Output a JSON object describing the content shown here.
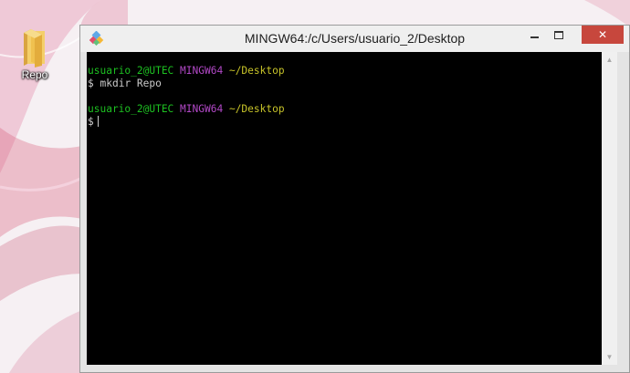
{
  "desktop": {
    "icons": [
      {
        "label": "Repo",
        "icon": "folder-icon"
      }
    ]
  },
  "window": {
    "title": "MINGW64:/c/Users/usuario_2/Desktop",
    "controls": {
      "minimize": "minimize-icon",
      "maximize": "maximize-icon",
      "close": "✕"
    }
  },
  "terminal": {
    "lines": [
      {
        "user": "usuario_2@UTEC",
        "host": "MINGW64",
        "path": "~/Desktop"
      },
      {
        "prompt": "$",
        "command": "mkdir Repo"
      },
      {
        "user": "usuario_2@UTEC",
        "host": "MINGW64",
        "path": "~/Desktop"
      },
      {
        "prompt": "$",
        "command": ""
      }
    ]
  },
  "colors": {
    "user": "#1dc121",
    "host": "#b148c6",
    "path": "#c7c329",
    "text": "#cbcbcb",
    "background": "#000000",
    "close": "#c7473d"
  }
}
